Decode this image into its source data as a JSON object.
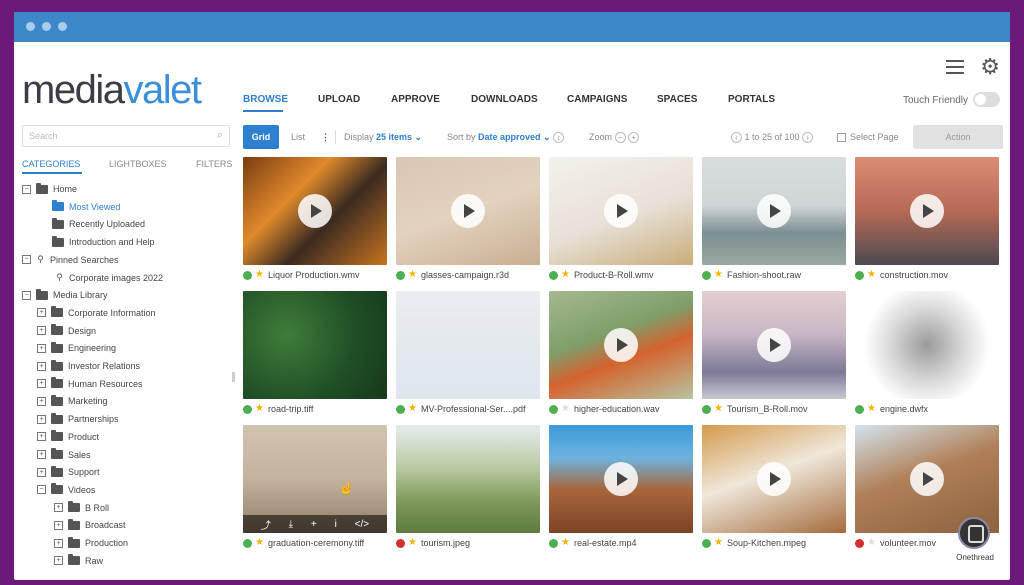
{
  "logo": {
    "part1": "media",
    "part2": "valet"
  },
  "nav": {
    "items": [
      "BROWSE",
      "UPLOAD",
      "APPROVE",
      "DOWNLOADS",
      "CAMPAIGNS",
      "SPACES",
      "PORTALS"
    ],
    "active": "BROWSE",
    "touch_label": "Touch Friendly"
  },
  "search": {
    "placeholder": "Search"
  },
  "left_tabs": [
    "CATEGORIES",
    "LIGHTBOXES",
    "FILTERS"
  ],
  "tree": [
    {
      "label": "Home",
      "level": 0,
      "kind": "folder",
      "toggle": "−"
    },
    {
      "label": "Most Viewed",
      "level": 1,
      "kind": "folder-open",
      "highlight": true
    },
    {
      "label": "Recently Uploaded",
      "level": 1,
      "kind": "folder"
    },
    {
      "label": "Introduction and Help",
      "level": 1,
      "kind": "folder"
    },
    {
      "label": "Pinned Searches",
      "level": 0,
      "kind": "pin",
      "toggle": "−"
    },
    {
      "label": "Corporate images 2022",
      "level": 1,
      "kind": "pin"
    },
    {
      "label": "Media Library",
      "level": 0,
      "kind": "folder",
      "toggle": "−"
    },
    {
      "label": "Corporate Information",
      "level": 1,
      "kind": "folder",
      "toggle": "+"
    },
    {
      "label": "Design",
      "level": 1,
      "kind": "folder",
      "toggle": "+"
    },
    {
      "label": "Engineering",
      "level": 1,
      "kind": "folder",
      "toggle": "+"
    },
    {
      "label": "Investor Relations",
      "level": 1,
      "kind": "folder",
      "toggle": "+"
    },
    {
      "label": "Human Resources",
      "level": 1,
      "kind": "folder",
      "toggle": "+"
    },
    {
      "label": "Marketing",
      "level": 1,
      "kind": "folder",
      "toggle": "+"
    },
    {
      "label": "Partnerships",
      "level": 1,
      "kind": "folder",
      "toggle": "+"
    },
    {
      "label": "Product",
      "level": 1,
      "kind": "folder",
      "toggle": "+"
    },
    {
      "label": "Sales",
      "level": 1,
      "kind": "folder",
      "toggle": "+"
    },
    {
      "label": "Support",
      "level": 1,
      "kind": "folder",
      "toggle": "+"
    },
    {
      "label": "Videos",
      "level": 1,
      "kind": "folder",
      "toggle": "−"
    },
    {
      "label": "B Roll",
      "level": 2,
      "kind": "folder",
      "toggle": "+"
    },
    {
      "label": "Broadcast",
      "level": 2,
      "kind": "folder",
      "toggle": "+"
    },
    {
      "label": "Production",
      "level": 2,
      "kind": "folder",
      "toggle": "+"
    },
    {
      "label": "Raw",
      "level": 2,
      "kind": "folder",
      "toggle": "+"
    }
  ],
  "toolbar": {
    "grid_label": "Grid",
    "list_label": "List",
    "more_icon": "⋮",
    "display_label": "Display",
    "display_value": "25 items ⌄",
    "sort_label": "Sort by",
    "sort_value": "Date approved ⌄",
    "zoom_label": "Zoom",
    "pager": "1 to 25 of 100",
    "select_page_label": "Select Page",
    "action_label": "Action"
  },
  "assets": [
    {
      "name": "Liquor Production.wmv",
      "video": true,
      "status": "#4caf50",
      "star": "#f5b400",
      "bg": "linear-gradient(135deg,#7a3c12 0%,#e08a2a 35%,#3b2a20 60%,#c8731f 100%)"
    },
    {
      "name": "glasses-campaign.r3d",
      "video": true,
      "status": "#4caf50",
      "star": "#f5b400",
      "bg": "linear-gradient(160deg,#d9c7b3 0%,#e3d2bd 50%,#c9ae92 100%)"
    },
    {
      "name": "Product-B-Roll.wmv",
      "video": true,
      "status": "#4caf50",
      "star": "#f5b400",
      "bg": "linear-gradient(160deg,#f4f1ec 0%,#e7e0d6 55%,#c9ac7a 100%)"
    },
    {
      "name": "Fashion-shoot.raw",
      "video": true,
      "status": "#4caf50",
      "star": "#f5b400",
      "bg": "linear-gradient(180deg,#d9dde0 0%,#cfd4d6 45%,#7d8f92 70%,#9aa7a3 100%)"
    },
    {
      "name": "construction.mov",
      "video": true,
      "status": "#4caf50",
      "star": "#f5b400",
      "bg": "linear-gradient(180deg,#d88d74 0%,#b66a55 50%,#4b4a52 100%)"
    },
    {
      "name": "road-trip.tiff",
      "video": false,
      "status": "#4caf50",
      "star": "#f5b400",
      "bg": "radial-gradient(circle at 30% 40%,#3f7d3a 0%,#1f4d25 60%,#163a1b 100%)"
    },
    {
      "name": "MV-Professional-Ser....pdf",
      "video": false,
      "status": "#4caf50",
      "star": "#f5b400",
      "bg": "linear-gradient(180deg,#e9ecef 0%,#dfe6ee 100%)"
    },
    {
      "name": "higher-education.wav",
      "video": true,
      "status": "#4caf50",
      "star": "#dddddd",
      "bg": "linear-gradient(160deg,#a5b98f 0%,#7f9e6b 40%,#d4632e 60%,#b7c4a0 100%)"
    },
    {
      "name": "Tourism_B-Roll.mov",
      "video": true,
      "status": "#4caf50",
      "star": "#f5b400",
      "bg": "linear-gradient(180deg,#e4cfd0 0%,#c9b6c5 40%,#7d7a97 75%,#c8c8d4 100%)"
    },
    {
      "name": "engine.dwfx",
      "video": false,
      "status": "#4caf50",
      "star": "#f5b400",
      "bg": "radial-gradient(circle at 50% 50%,#9a9a9a 0%,#d8d8d8 40%,#ffffff 70%)"
    },
    {
      "name": "graduation-ceremony.tiff",
      "video": false,
      "status": "#4caf50",
      "star": "#f5b400",
      "bg": "linear-gradient(180deg,#d1c3b1 0%,#c4b39d 50%,#8f7c66 100%)",
      "hover": true
    },
    {
      "name": "tourism.jpeg",
      "video": false,
      "status": "#d32f2f",
      "star": "#f5b400",
      "bg": "linear-gradient(180deg,#e7ecef 0%,#b9c9a2 40%,#7f9a5a 70%,#5e7a3f 100%)"
    },
    {
      "name": "real-estate.mp4",
      "video": true,
      "status": "#4caf50",
      "star": "#f5b400",
      "bg": "linear-gradient(180deg,#3c9ad6 0%,#6bb3e0 30%,#a9653c 60%,#7b4326 100%)"
    },
    {
      "name": "Soup-Kitchen.mpeg",
      "video": true,
      "status": "#4caf50",
      "star": "#f5b400",
      "bg": "linear-gradient(160deg,#d49a4d 0%,#efe7da 45%,#a46b3c 100%)"
    },
    {
      "name": "volunteer.mov",
      "video": true,
      "status": "#d32f2f",
      "star": "#dddddd",
      "bg": "linear-gradient(160deg,#d3e3ee 0%,#b08058 45%,#8d6240 100%)"
    }
  ],
  "hover_icons": [
    "⤴",
    "⤓",
    "+",
    "i",
    "</>"
  ],
  "watermark": "Onethread"
}
